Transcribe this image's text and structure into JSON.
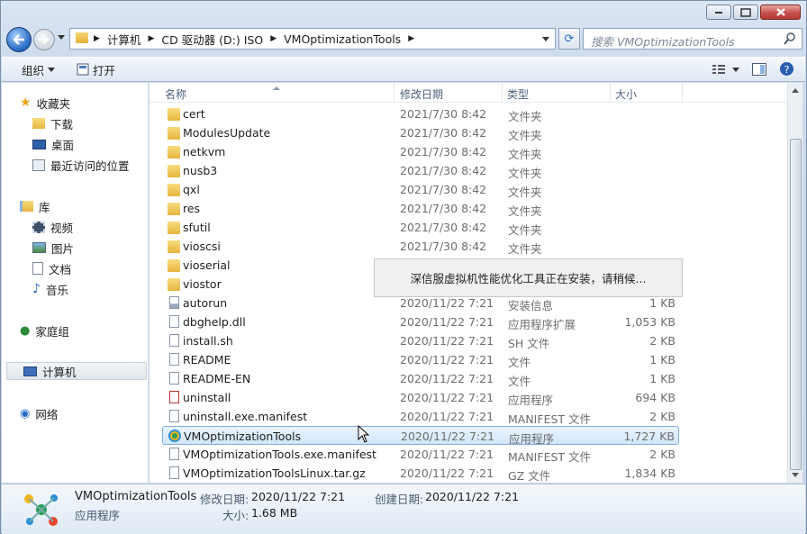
{
  "address": {
    "crumbs": [
      "计算机",
      "CD 驱动器 (D:) ISO",
      "VMOptimizationTools"
    ],
    "search_placeholder": "搜索 VMOptimizationTools"
  },
  "toolbar": {
    "organize": "组织",
    "open": "打开"
  },
  "nav": {
    "favorites": "收藏夹",
    "downloads": "下载",
    "desktop": "桌面",
    "recent": "最近访问的位置",
    "libraries": "库",
    "videos": "视频",
    "pictures": "图片",
    "documents": "文档",
    "music": "音乐",
    "homegroup": "家庭组",
    "computer": "计算机",
    "network": "网络"
  },
  "columns": {
    "name": "名称",
    "date": "修改日期",
    "type": "类型",
    "size": "大小"
  },
  "files": [
    {
      "name": "cert",
      "date": "2021/7/30 8:42",
      "type": "文件夹",
      "size": "",
      "icon": "folder-icon"
    },
    {
      "name": "ModulesUpdate",
      "date": "2021/7/30 8:42",
      "type": "文件夹",
      "size": "",
      "icon": "folder-icon"
    },
    {
      "name": "netkvm",
      "date": "2021/7/30 8:42",
      "type": "文件夹",
      "size": "",
      "icon": "folder-icon"
    },
    {
      "name": "nusb3",
      "date": "2021/7/30 8:42",
      "type": "文件夹",
      "size": "",
      "icon": "folder-icon"
    },
    {
      "name": "qxl",
      "date": "2021/7/30 8:42",
      "type": "文件夹",
      "size": "",
      "icon": "folder-icon"
    },
    {
      "name": "res",
      "date": "2021/7/30 8:42",
      "type": "文件夹",
      "size": "",
      "icon": "folder-icon"
    },
    {
      "name": "sfutil",
      "date": "2021/7/30 8:42",
      "type": "文件夹",
      "size": "",
      "icon": "folder-icon"
    },
    {
      "name": "vioscsi",
      "date": "2021/7/30 8:42",
      "type": "文件夹",
      "size": "",
      "icon": "folder-icon"
    },
    {
      "name": "vioserial",
      "date": "",
      "type": "",
      "size": "",
      "icon": "folder-icon"
    },
    {
      "name": "viostor",
      "date": "",
      "type": "",
      "size": "",
      "icon": "folder-icon"
    },
    {
      "name": "autorun",
      "date": "2020/11/22 7:21",
      "type": "安装信息",
      "size": "1 KB",
      "icon": "settings-file-icon"
    },
    {
      "name": "dbghelp.dll",
      "date": "2020/11/22 7:21",
      "type": "应用程序扩展",
      "size": "1,053 KB",
      "icon": "dll-file-icon"
    },
    {
      "name": "install.sh",
      "date": "2020/11/22 7:21",
      "type": "SH 文件",
      "size": "2 KB",
      "icon": "file-icon"
    },
    {
      "name": "README",
      "date": "2020/11/22 7:21",
      "type": "文件",
      "size": "1 KB",
      "icon": "file-icon"
    },
    {
      "name": "README-EN",
      "date": "2020/11/22 7:21",
      "type": "文件",
      "size": "1 KB",
      "icon": "file-icon"
    },
    {
      "name": "uninstall",
      "date": "2020/11/22 7:21",
      "type": "应用程序",
      "size": "694 KB",
      "icon": "uninstall-app-icon"
    },
    {
      "name": "uninstall.exe.manifest",
      "date": "2020/11/22 7:21",
      "type": "MANIFEST 文件",
      "size": "2 KB",
      "icon": "file-icon"
    },
    {
      "name": "VMOptimizationTools",
      "date": "2020/11/22 7:21",
      "type": "应用程序",
      "size": "1,727 KB",
      "icon": "app-icon"
    },
    {
      "name": "VMOptimizationTools.exe.manifest",
      "date": "2020/11/22 7:21",
      "type": "MANIFEST 文件",
      "size": "2 KB",
      "icon": "file-icon"
    },
    {
      "name": "VMOptimizationToolsLinux.tar.gz",
      "date": "2020/11/22 7:21",
      "type": "GZ 文件",
      "size": "1,834 KB",
      "icon": "file-icon"
    }
  ],
  "popup": {
    "message": "深信服虚拟机性能优化工具正在安装，请稍候..."
  },
  "details": {
    "name": "VMOptimizationTools",
    "type": "应用程序",
    "modified_label": "修改日期:",
    "modified": "2020/11/22 7:21",
    "created_label": "创建日期:",
    "created": "2020/11/22 7:21",
    "size_label": "大小:",
    "size": "1.68 MB"
  },
  "colors": {
    "accent": "#2a6cc4",
    "selection": "#d2e6fb",
    "folder": "#e6b53e"
  }
}
